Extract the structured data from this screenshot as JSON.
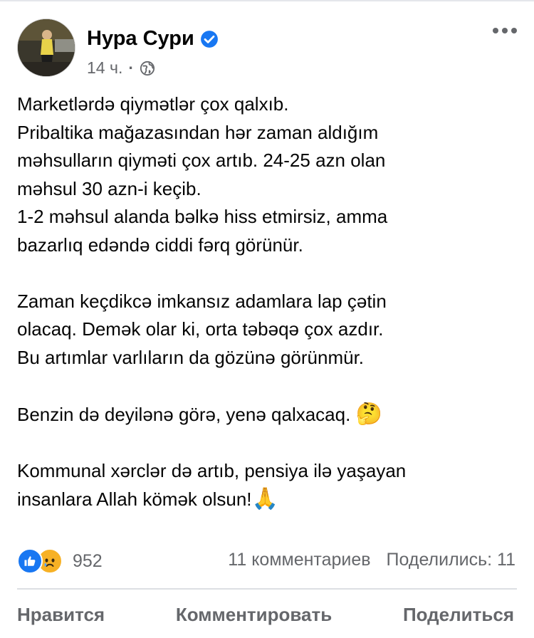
{
  "post": {
    "author": "Нура Сури",
    "time": "14 ч.",
    "separator": "·",
    "lines_block1": [
      "Marketlərdə qiymətlər çox qalxıb.",
      "Pribaltika mağazasından hər zaman aldığım",
      "məhsulların qiyməti çox artıb. 24-25 azn olan",
      "məhsul 30 azn-i keçib.",
      "1-2 məhsul alanda bəlkə hiss etmirsiz, amma",
      "bazarlıq edəndə ciddi fərq görünür."
    ],
    "lines_block2": [
      "Zaman keçdikcə imkansız adamlara lap çətin",
      "olacaq. Demək olar ki, orta təbəqə çox azdır.",
      "Bu artımlar varlıların da gözünə görünmür."
    ],
    "line_block3": "Benzin də deyilənə görə, yenə qalxacaq.",
    "emoji_thinking": "🤔",
    "lines_block4": [
      "Kommunal xərclər də artıb, pensiya ilə yaşayan",
      "insanlara Allah kömək olsun!"
    ],
    "emoji_pray": "🙏"
  },
  "stats": {
    "reactions_count": "952",
    "comments": "11 комментариев",
    "shares": "Поделились: 11",
    "reaction_icons": [
      "like-icon",
      "sad-face-icon"
    ]
  },
  "actions": {
    "like": "Нравится",
    "comment": "Комментировать",
    "share": "Поделиться"
  },
  "colors": {
    "verified_blue": "#1877f2",
    "meta_gray": "#65676b",
    "text": "#050505",
    "sad_yellow": "#f7b125"
  }
}
